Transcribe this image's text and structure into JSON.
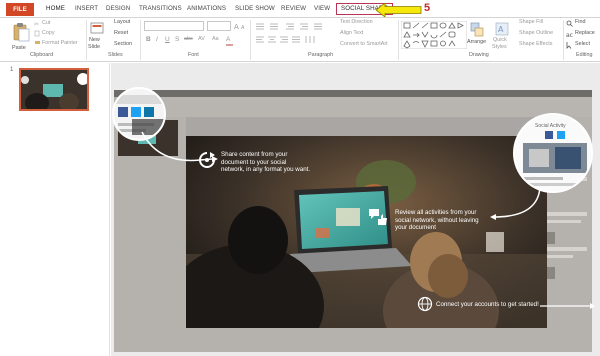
{
  "tabs": [
    "FILE",
    "HOME",
    "INSERT",
    "DESIGN",
    "TRANSITIONS",
    "ANIMATIONS",
    "SLIDE SHOW",
    "REVIEW",
    "VIEW",
    "SOCIAL SHARE"
  ],
  "active_tab": "HOME",
  "highlighted_tab": "SOCIAL SHARE",
  "callout_number": "5",
  "ribbon": {
    "clipboard": {
      "paste": "Paste",
      "cut": "Cut",
      "copy": "Copy",
      "format_painter": "Format Painter",
      "label": "Clipboard"
    },
    "slides": {
      "new_slide_1": "New",
      "new_slide_2": "Slide",
      "layout": "Layout",
      "reset": "Reset",
      "section": "Section",
      "label": "Slides"
    },
    "font": {
      "bold": "B",
      "italic": "I",
      "underline": "U",
      "strike": "S",
      "shadow": "abc",
      "spacing": "AV",
      "case": "Aa",
      "color": "A",
      "label": "Font"
    },
    "paragraph": {
      "text_direction": "Text Direction",
      "align_text": "Align Text",
      "convert_smartart": "Convert to SmartArt",
      "label": "Paragraph"
    },
    "drawing": {
      "arrange": "Arrange",
      "quick_styles_1": "Quick",
      "quick_styles_2": "Styles",
      "shape_fill": "Shape Fill",
      "shape_outline": "Shape Outline",
      "shape_effects": "Shape Effects",
      "label": "Drawing"
    },
    "editing": {
      "find": "Find",
      "replace": "Replace",
      "select": "Select",
      "label": "Editing"
    }
  },
  "slide_number": "1",
  "overlay": {
    "share_text": [
      "Share content from your",
      "document to your social",
      "network, in any format you want."
    ],
    "review_text": [
      "Review all activities from your",
      "social network, without leaving",
      "your document"
    ],
    "connect_text": "Connect your accounts to get started!"
  },
  "colors": {
    "file_tab": "#d24726",
    "callout_arrow": "#f5e80a",
    "callout_number": "#c1272d",
    "thumb_border": "#d35f3c"
  }
}
